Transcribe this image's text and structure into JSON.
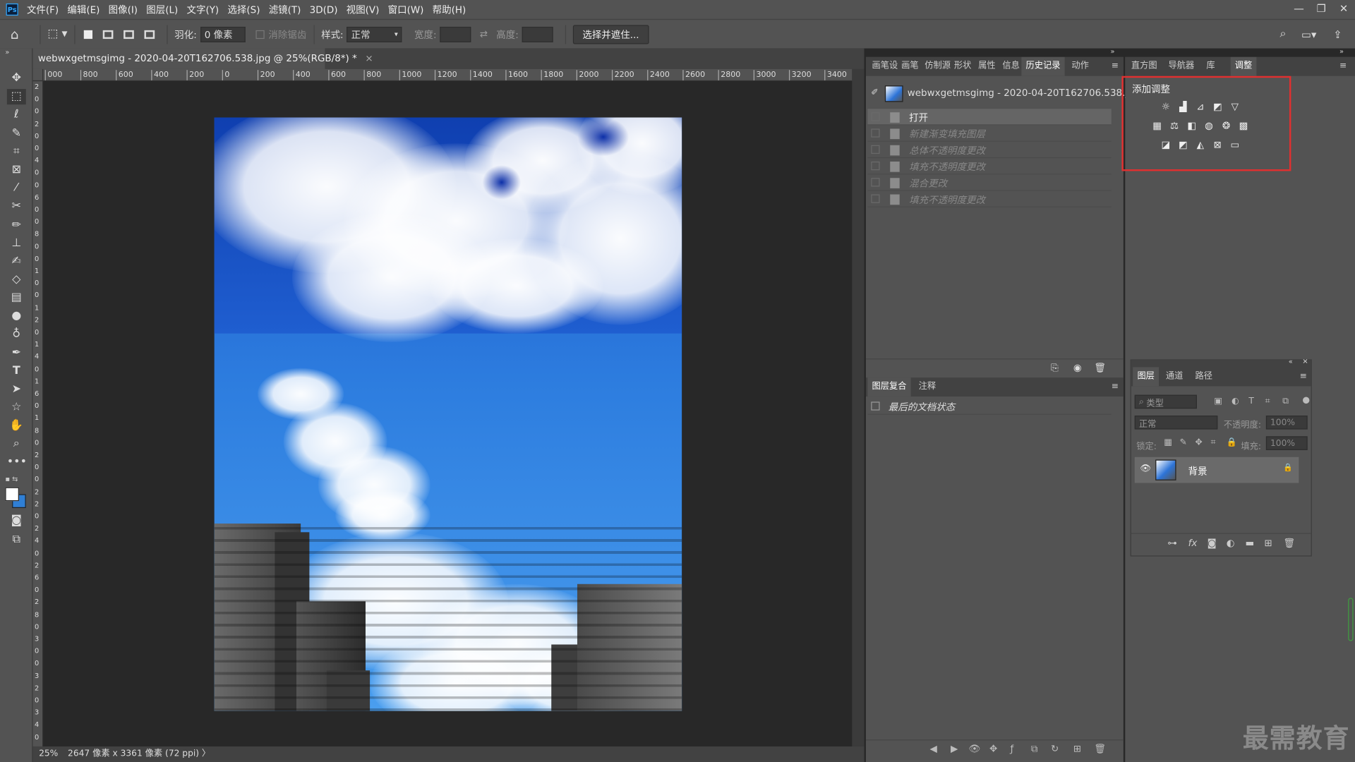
{
  "app": {
    "logo": "Ps"
  },
  "menu": [
    "文件(F)",
    "编辑(E)",
    "图像(I)",
    "图层(L)",
    "文字(Y)",
    "选择(S)",
    "滤镜(T)",
    "3D(D)",
    "视图(V)",
    "窗口(W)",
    "帮助(H)"
  ],
  "window_controls": {
    "minimize": "—",
    "restore": "❐",
    "close": "✕"
  },
  "options": {
    "feather_label": "羽化:",
    "feather_value": "0 像素",
    "antialias_label": "消除锯齿",
    "style_label": "样式:",
    "style_value": "正常",
    "width_label": "宽度:",
    "height_label": "高度:",
    "select_mask": "选择并遮住..."
  },
  "document": {
    "tab_title": "webwxgetmsgimg - 2020-04-20T162706.538.jpg @ 25%(RGB/8*) *",
    "close": "×"
  },
  "ruler_h": [
    "000",
    "800",
    "600",
    "400",
    "200",
    "0",
    "200",
    "400",
    "600",
    "800",
    "1000",
    "1200",
    "1400",
    "1600",
    "1800",
    "2000",
    "2200",
    "2400",
    "2600",
    "2800",
    "3000",
    "3200",
    "3400"
  ],
  "ruler_v": [
    "2",
    "0",
    "0",
    "2",
    "0",
    "0",
    "4",
    "0",
    "0",
    "6",
    "0",
    "0",
    "8",
    "0",
    "0",
    "1",
    "0",
    "0",
    "1",
    "2",
    "0",
    "1",
    "4",
    "0",
    "1",
    "6",
    "0",
    "1",
    "8",
    "0",
    "2",
    "0",
    "0",
    "2",
    "2",
    "0",
    "2",
    "4",
    "0",
    "2",
    "6",
    "0",
    "2",
    "8",
    "0",
    "3",
    "0",
    "0",
    "3",
    "2",
    "0",
    "3",
    "4",
    "0"
  ],
  "status": {
    "zoom": "25%",
    "dims": "2647 像素 x 3361 像素 (72 ppi)",
    "arrow": "〉"
  },
  "left_panel": {
    "tabs": [
      "画笔设",
      "画笔",
      "仿制源",
      "形状",
      "属性",
      "信息",
      "历史记录",
      "动作"
    ],
    "active_tab": "历史记录",
    "snapshot_name": "webwxgetmsgimg - 2020-04-20T162706.538.jpg",
    "history": [
      "打开",
      "新建渐变填充图层",
      "总体不透明度更改",
      "填充不透明度更改",
      "混合更改",
      "填充不透明度更改"
    ],
    "comp_tabs": [
      "图层复合",
      "注释"
    ],
    "comp_item": "最后的文档状态"
  },
  "right_panel": {
    "tabs": [
      "直方图",
      "导航器",
      "库",
      "调整"
    ],
    "active_tab": "调整",
    "adjust_title": "添加调整",
    "highlight_color": "#e03030"
  },
  "layers_panel": {
    "tabs": [
      "图层",
      "通道",
      "路径"
    ],
    "filter_kind": "类型",
    "blend_mode": "正常",
    "opacity_label": "不透明度:",
    "opacity_value": "100%",
    "lock_label": "锁定:",
    "fill_label": "填充:",
    "fill_value": "100%",
    "layer_name": "背景"
  },
  "watermark": "最需教育"
}
